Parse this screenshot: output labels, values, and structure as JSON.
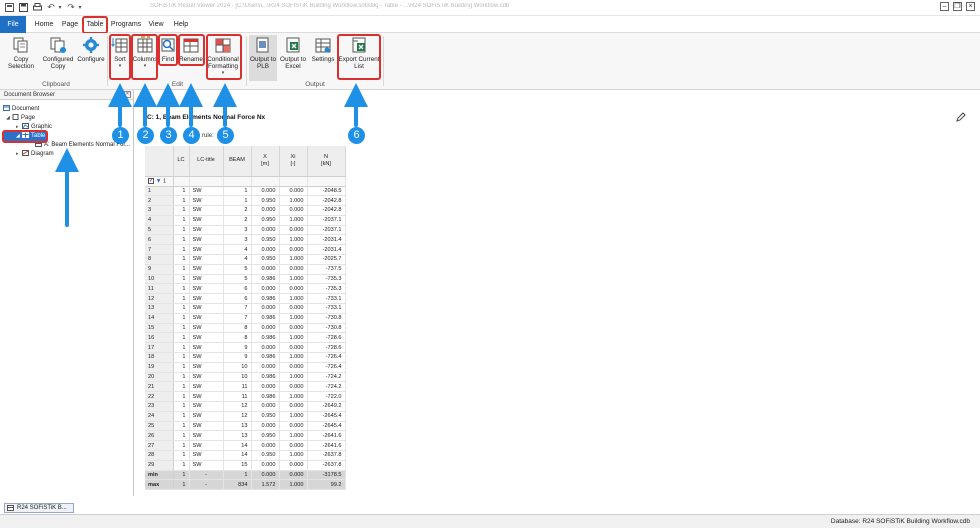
{
  "window": {
    "title": "SOFiSTiK Result Viewer 2024 - [C:\\Users\\...\\R24 SOFiSTiK Building Workflow.sofistik] - Table - ...\\R24 SOFiSTiK Building Workflow.cdb"
  },
  "menu": {
    "file": "File",
    "home": "Home",
    "page": "Page",
    "table": "Table",
    "programs": "Programs",
    "view": "View",
    "help": "Help"
  },
  "ribbon": {
    "copy_selection": "Copy Selection",
    "configured_copy": "Configured Copy",
    "configure": "Configure",
    "sort": "Sort",
    "columns": "Columns",
    "find": "Find",
    "rename": "Rename",
    "conditional_formatting": "Conditional Formatting",
    "output_to_plb": "Output to PLB",
    "output_to_excel": "Output to Excel",
    "settings": "Settings",
    "export_current_list": "Export Current List",
    "group_clipboard": "Clipboard",
    "group_edit": "Edit",
    "group_output": "Output"
  },
  "doc_browser": {
    "header": "Document Browser",
    "items": [
      "Document",
      "Page",
      "Graphic",
      "Table",
      "A: Beam Elements Normal For...",
      "Diagram"
    ]
  },
  "sheet": {
    "title": "C: 1, Beam Elements Normal Force Nx",
    "rule_label": "rule:"
  },
  "table": {
    "headers": [
      "LC",
      "LC-title",
      "BEAM",
      "X\n[m]",
      "Xi\n[-]",
      "N\n[kN]"
    ],
    "filter_text": "1",
    "rows": [
      [
        "1",
        "1",
        "SW",
        "1",
        "0.000",
        "0.000",
        "-2048.5"
      ],
      [
        "2",
        "1",
        "SW",
        "1",
        "0.950",
        "1.000",
        "-2042.8"
      ],
      [
        "3",
        "1",
        "SW",
        "2",
        "0.000",
        "0.000",
        "-2042.8"
      ],
      [
        "4",
        "1",
        "SW",
        "2",
        "0.950",
        "1.000",
        "-2037.1"
      ],
      [
        "5",
        "1",
        "SW",
        "3",
        "0.000",
        "0.000",
        "-2037.1"
      ],
      [
        "6",
        "1",
        "SW",
        "3",
        "0.950",
        "1.000",
        "-2031.4"
      ],
      [
        "7",
        "1",
        "SW",
        "4",
        "0.000",
        "0.000",
        "-2031.4"
      ],
      [
        "8",
        "1",
        "SW",
        "4",
        "0.950",
        "1.000",
        "-2025.7"
      ],
      [
        "9",
        "1",
        "SW",
        "5",
        "0.000",
        "0.000",
        "-737.5"
      ],
      [
        "10",
        "1",
        "SW",
        "5",
        "0.986",
        "1.000",
        "-735.3"
      ],
      [
        "11",
        "1",
        "SW",
        "6",
        "0.000",
        "0.000",
        "-735.3"
      ],
      [
        "12",
        "1",
        "SW",
        "6",
        "0.986",
        "1.000",
        "-733.1"
      ],
      [
        "13",
        "1",
        "SW",
        "7",
        "0.000",
        "0.000",
        "-733.1"
      ],
      [
        "14",
        "1",
        "SW",
        "7",
        "0.986",
        "1.000",
        "-730.8"
      ],
      [
        "15",
        "1",
        "SW",
        "8",
        "0.000",
        "0.000",
        "-730.8"
      ],
      [
        "16",
        "1",
        "SW",
        "8",
        "0.986",
        "1.000",
        "-728.6"
      ],
      [
        "17",
        "1",
        "SW",
        "9",
        "0.000",
        "0.000",
        "-728.6"
      ],
      [
        "18",
        "1",
        "SW",
        "9",
        "0.986",
        "1.000",
        "-726.4"
      ],
      [
        "19",
        "1",
        "SW",
        "10",
        "0.000",
        "0.000",
        "-726.4"
      ],
      [
        "20",
        "1",
        "SW",
        "10",
        "0.986",
        "1.000",
        "-724.2"
      ],
      [
        "21",
        "1",
        "SW",
        "11",
        "0.000",
        "0.000",
        "-724.2"
      ],
      [
        "22",
        "1",
        "SW",
        "11",
        "0.986",
        "1.000",
        "-722.0"
      ],
      [
        "23",
        "1",
        "SW",
        "12",
        "0.000",
        "0.000",
        "-2649.2"
      ],
      [
        "24",
        "1",
        "SW",
        "12",
        "0.950",
        "1.000",
        "-2645.4"
      ],
      [
        "25",
        "1",
        "SW",
        "13",
        "0.000",
        "0.000",
        "-2645.4"
      ],
      [
        "26",
        "1",
        "SW",
        "13",
        "0.950",
        "1.000",
        "-2641.6"
      ],
      [
        "27",
        "1",
        "SW",
        "14",
        "0.000",
        "0.000",
        "-2641.6"
      ],
      [
        "28",
        "1",
        "SW",
        "14",
        "0.950",
        "1.000",
        "-2637.8"
      ],
      [
        "29",
        "1",
        "SW",
        "15",
        "0.000",
        "0.000",
        "-2637.8"
      ]
    ],
    "min_row": [
      "min",
      "1",
      "-",
      "1",
      "0.000",
      "0.000",
      "-3178.5"
    ],
    "max_row": [
      "max",
      "1",
      "-",
      "834",
      "1.572",
      "1.000",
      "99.2"
    ]
  },
  "callouts": [
    "1",
    "2",
    "3",
    "4",
    "5",
    "6"
  ],
  "bottom_tab": "R24 SOFiSTiK B...",
  "status": "Database: R24 SOFiSTiK Building Workflow.cdb",
  "colors": {
    "accent": "#1f6fc5",
    "annotation_red": "#d93030",
    "annotation_blue": "#1e90e6"
  }
}
